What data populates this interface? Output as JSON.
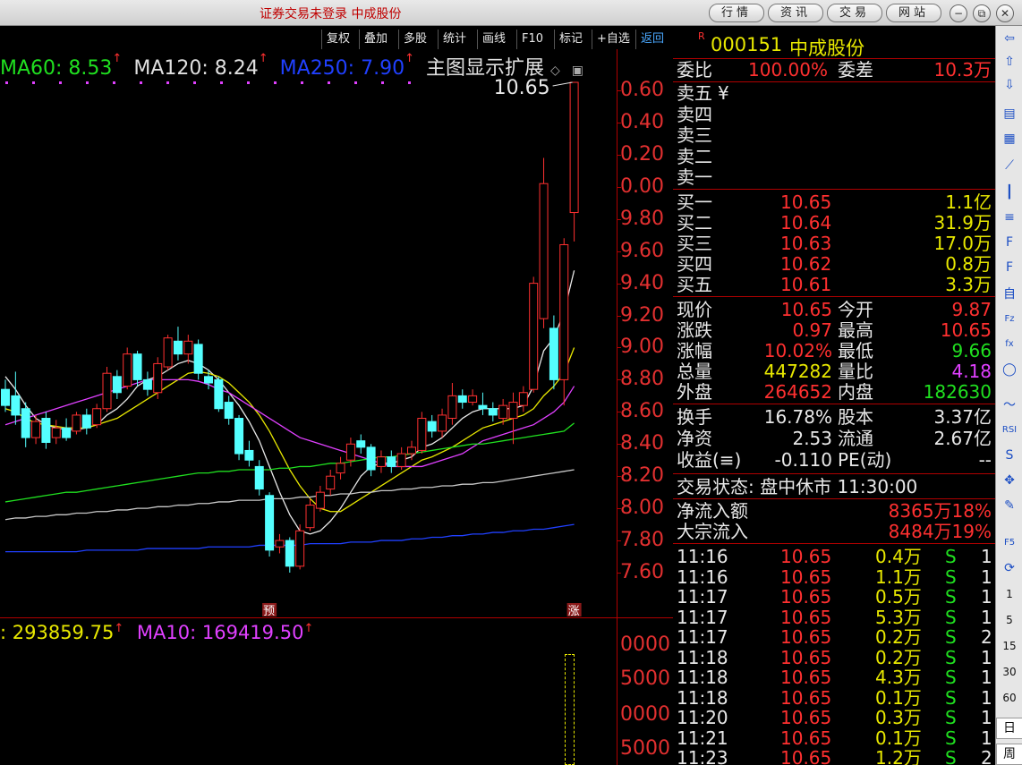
{
  "window": {
    "title": "证券交易未登录  中成股份",
    "top_buttons": [
      "行情",
      "资讯",
      "交易",
      "网站"
    ]
  },
  "toolbar": {
    "items": [
      "复权",
      "叠加",
      "多股",
      "统计",
      "画线",
      "F10",
      "标记",
      "+自选",
      "返回"
    ]
  },
  "ma_legend": {
    "ma60": "MA60: 8.53",
    "ma120": "MA120: 8.24",
    "ma250": "MA250: 7.90",
    "ext": "主图显示扩展",
    "colors": {
      "ma60": "#20e020",
      "ma120": "#e0e0e0",
      "ma250": "#2040ff",
      "ext": "#e0e0e0"
    }
  },
  "chart_data": {
    "type": "candlestick",
    "title": "",
    "ylim": [
      7.55,
      10.7
    ],
    "y_ticks": [
      "0.60",
      "0.40",
      "0.20",
      "0.00",
      "9.80",
      "9.60",
      "9.40",
      "9.20",
      "9.00",
      "8.80",
      "8.60",
      "8.40",
      "8.20",
      "8.00",
      "7.80",
      "7.60"
    ],
    "y_tick_values": [
      10.6,
      10.4,
      10.2,
      10.0,
      9.8,
      9.6,
      9.4,
      9.2,
      9.0,
      8.8,
      8.6,
      8.4,
      8.2,
      8.0,
      7.8,
      7.6
    ],
    "high_annotation": "10.65",
    "candles": [
      {
        "o": 8.74,
        "c": 8.64,
        "h": 8.8,
        "l": 8.6
      },
      {
        "o": 8.7,
        "c": 8.58,
        "h": 8.85,
        "l": 8.52
      },
      {
        "o": 8.62,
        "c": 8.44,
        "h": 8.66,
        "l": 8.38
      },
      {
        "o": 8.44,
        "c": 8.54,
        "h": 8.58,
        "l": 8.4
      },
      {
        "o": 8.56,
        "c": 8.41,
        "h": 8.6,
        "l": 8.37
      },
      {
        "o": 8.44,
        "c": 8.5,
        "h": 8.55,
        "l": 8.4
      },
      {
        "o": 8.5,
        "c": 8.44,
        "h": 8.56,
        "l": 8.42
      },
      {
        "o": 8.48,
        "c": 8.58,
        "h": 8.6,
        "l": 8.46
      },
      {
        "o": 8.58,
        "c": 8.5,
        "h": 8.62,
        "l": 8.46
      },
      {
        "o": 8.52,
        "c": 8.62,
        "h": 8.65,
        "l": 8.5
      },
      {
        "o": 8.62,
        "c": 8.84,
        "h": 8.88,
        "l": 8.6
      },
      {
        "o": 8.82,
        "c": 8.72,
        "h": 8.86,
        "l": 8.68
      },
      {
        "o": 8.76,
        "c": 8.96,
        "h": 9.0,
        "l": 8.74
      },
      {
        "o": 8.96,
        "c": 8.8,
        "h": 8.98,
        "l": 8.76
      },
      {
        "o": 8.8,
        "c": 8.74,
        "h": 8.85,
        "l": 8.7
      },
      {
        "o": 8.72,
        "c": 8.9,
        "h": 8.94,
        "l": 8.68
      },
      {
        "o": 8.88,
        "c": 9.06,
        "h": 9.08,
        "l": 8.86
      },
      {
        "o": 9.04,
        "c": 8.96,
        "h": 9.13,
        "l": 8.92
      },
      {
        "o": 8.96,
        "c": 9.04,
        "h": 9.08,
        "l": 8.9
      },
      {
        "o": 9.02,
        "c": 8.84,
        "h": 9.05,
        "l": 8.8
      },
      {
        "o": 8.82,
        "c": 8.78,
        "h": 8.86,
        "l": 8.74
      },
      {
        "o": 8.8,
        "c": 8.62,
        "h": 8.82,
        "l": 8.6
      },
      {
        "o": 8.66,
        "c": 8.56,
        "h": 8.7,
        "l": 8.52
      },
      {
        "o": 8.56,
        "c": 8.34,
        "h": 8.58,
        "l": 8.3
      },
      {
        "o": 8.36,
        "c": 8.3,
        "h": 8.42,
        "l": 8.26
      },
      {
        "o": 8.26,
        "c": 8.12,
        "h": 8.3,
        "l": 8.08
      },
      {
        "o": 8.08,
        "c": 7.74,
        "h": 8.1,
        "l": 7.7
      },
      {
        "o": 7.76,
        "c": 7.8,
        "h": 7.84,
        "l": 7.72
      },
      {
        "o": 7.8,
        "c": 7.64,
        "h": 7.82,
        "l": 7.6
      },
      {
        "o": 7.64,
        "c": 7.86,
        "h": 7.9,
        "l": 7.62
      },
      {
        "o": 7.88,
        "c": 8.02,
        "h": 8.06,
        "l": 7.86
      },
      {
        "o": 8.0,
        "c": 8.1,
        "h": 8.14,
        "l": 7.98
      },
      {
        "o": 8.12,
        "c": 8.2,
        "h": 8.24,
        "l": 8.08
      },
      {
        "o": 8.22,
        "c": 8.28,
        "h": 8.32,
        "l": 8.18
      },
      {
        "o": 8.3,
        "c": 8.4,
        "h": 8.44,
        "l": 8.26
      },
      {
        "o": 8.42,
        "c": 8.38,
        "h": 8.46,
        "l": 8.34
      },
      {
        "o": 8.38,
        "c": 8.24,
        "h": 8.4,
        "l": 8.2
      },
      {
        "o": 8.26,
        "c": 8.32,
        "h": 8.36,
        "l": 8.22
      },
      {
        "o": 8.32,
        "c": 8.26,
        "h": 8.36,
        "l": 8.22
      },
      {
        "o": 8.26,
        "c": 8.34,
        "h": 8.38,
        "l": 8.24
      },
      {
        "o": 8.34,
        "c": 8.38,
        "h": 8.42,
        "l": 8.3
      },
      {
        "o": 8.36,
        "c": 8.56,
        "h": 8.6,
        "l": 8.34
      },
      {
        "o": 8.54,
        "c": 8.48,
        "h": 8.58,
        "l": 8.44
      },
      {
        "o": 8.48,
        "c": 8.58,
        "h": 8.62,
        "l": 8.44
      },
      {
        "o": 8.56,
        "c": 8.7,
        "h": 8.78,
        "l": 8.52
      },
      {
        "o": 8.7,
        "c": 8.66,
        "h": 8.74,
        "l": 8.62
      },
      {
        "o": 8.66,
        "c": 8.7,
        "h": 8.74,
        "l": 8.64
      },
      {
        "o": 8.64,
        "c": 8.62,
        "h": 8.72,
        "l": 8.58
      },
      {
        "o": 8.62,
        "c": 8.58,
        "h": 8.66,
        "l": 8.54
      },
      {
        "o": 8.56,
        "c": 8.64,
        "h": 8.68,
        "l": 8.52
      },
      {
        "o": 8.56,
        "c": 8.66,
        "h": 8.72,
        "l": 8.4
      },
      {
        "o": 8.64,
        "c": 8.72,
        "h": 8.76,
        "l": 8.6
      },
      {
        "o": 8.74,
        "c": 9.4,
        "h": 9.44,
        "l": 8.72
      },
      {
        "o": 9.18,
        "c": 10.02,
        "h": 10.18,
        "l": 9.12
      },
      {
        "o": 9.12,
        "c": 8.8,
        "h": 9.2,
        "l": 8.74
      },
      {
        "o": 8.8,
        "c": 9.64,
        "h": 9.68,
        "l": 8.64
      },
      {
        "o": 9.84,
        "c": 10.65,
        "h": 10.65,
        "l": 9.66
      }
    ],
    "ma_lines": [
      {
        "color": "#e8e8e8",
        "values": [
          8.82,
          8.74,
          8.64,
          8.56,
          8.52,
          8.5,
          8.49,
          8.49,
          8.5,
          8.52,
          8.58,
          8.62,
          8.68,
          8.76,
          8.8,
          8.82,
          8.86,
          8.9,
          8.92,
          8.9,
          8.86,
          8.8,
          8.72,
          8.64,
          8.54,
          8.42,
          8.26,
          8.1,
          7.96,
          7.86,
          7.84,
          7.86,
          7.92,
          8.0,
          8.1,
          8.2,
          8.26,
          8.28,
          8.28,
          8.3,
          8.32,
          8.38,
          8.4,
          8.44,
          8.5,
          8.56,
          8.6,
          8.62,
          8.62,
          8.62,
          8.62,
          8.64,
          8.76,
          8.98,
          9.06,
          9.22,
          9.48
        ]
      },
      {
        "color": "#e8e800",
        "values": [
          8.62,
          8.6,
          8.56,
          8.53,
          8.52,
          8.51,
          8.5,
          8.5,
          8.5,
          8.52,
          8.54,
          8.56,
          8.6,
          8.64,
          8.68,
          8.72,
          8.76,
          8.8,
          8.84,
          8.85,
          8.84,
          8.82,
          8.78,
          8.72,
          8.66,
          8.58,
          8.48,
          8.36,
          8.24,
          8.14,
          8.06,
          8.0,
          7.98,
          7.98,
          8.02,
          8.06,
          8.1,
          8.14,
          8.18,
          8.22,
          8.26,
          8.3,
          8.32,
          8.35,
          8.38,
          8.42,
          8.46,
          8.5,
          8.52,
          8.54,
          8.56,
          8.58,
          8.62,
          8.7,
          8.76,
          8.84,
          9.0
        ]
      },
      {
        "color": "#e040ff",
        "values": [
          8.52,
          8.54,
          8.56,
          8.58,
          8.6,
          8.62,
          8.64,
          8.66,
          8.68,
          8.7,
          8.72,
          8.74,
          8.76,
          8.78,
          8.8,
          8.8,
          8.8,
          8.8,
          8.8,
          8.79,
          8.77,
          8.74,
          8.72,
          8.68,
          8.64,
          8.6,
          8.56,
          8.52,
          8.48,
          8.44,
          8.42,
          8.4,
          8.38,
          8.36,
          8.34,
          8.32,
          8.3,
          8.28,
          8.26,
          8.26,
          8.26,
          8.26,
          8.28,
          8.3,
          8.32,
          8.34,
          8.38,
          8.42,
          8.44,
          8.46,
          8.48,
          8.5,
          8.52,
          8.56,
          8.6,
          8.66,
          8.76
        ]
      },
      {
        "color": "#20e020",
        "values": [
          8.04,
          8.05,
          8.06,
          8.07,
          8.08,
          8.09,
          8.1,
          8.1,
          8.11,
          8.12,
          8.13,
          8.14,
          8.15,
          8.16,
          8.17,
          8.18,
          8.19,
          8.2,
          8.21,
          8.22,
          8.22,
          8.23,
          8.23,
          8.24,
          8.24,
          8.24,
          8.24,
          8.25,
          8.25,
          8.26,
          8.26,
          8.27,
          8.28,
          8.28,
          8.29,
          8.3,
          8.31,
          8.32,
          8.32,
          8.33,
          8.34,
          8.35,
          8.36,
          8.37,
          8.38,
          8.39,
          8.4,
          8.4,
          8.41,
          8.42,
          8.43,
          8.44,
          8.45,
          8.46,
          8.47,
          8.48,
          8.53
        ]
      },
      {
        "color": "#c8c8c8",
        "values": [
          7.93,
          7.94,
          7.94,
          7.95,
          7.95,
          7.96,
          7.96,
          7.97,
          7.97,
          7.98,
          7.98,
          7.99,
          7.99,
          8.0,
          8.0,
          8.01,
          8.01,
          8.02,
          8.02,
          8.03,
          8.03,
          8.04,
          8.04,
          8.05,
          8.05,
          8.05,
          8.06,
          8.06,
          8.06,
          8.07,
          8.07,
          8.08,
          8.08,
          8.09,
          8.09,
          8.1,
          8.1,
          8.11,
          8.11,
          8.12,
          8.12,
          8.13,
          8.13,
          8.14,
          8.14,
          8.15,
          8.15,
          8.16,
          8.16,
          8.17,
          8.18,
          8.19,
          8.2,
          8.21,
          8.22,
          8.23,
          8.24
        ]
      },
      {
        "color": "#2040ff",
        "values": [
          7.73,
          7.73,
          7.73,
          7.73,
          7.73,
          7.73,
          7.73,
          7.73,
          7.74,
          7.74,
          7.74,
          7.74,
          7.74,
          7.74,
          7.75,
          7.75,
          7.75,
          7.75,
          7.75,
          7.75,
          7.76,
          7.76,
          7.76,
          7.76,
          7.76,
          7.77,
          7.77,
          7.77,
          7.77,
          7.77,
          7.78,
          7.78,
          7.78,
          7.78,
          7.79,
          7.79,
          7.79,
          7.8,
          7.8,
          7.8,
          7.81,
          7.81,
          7.82,
          7.82,
          7.83,
          7.83,
          7.84,
          7.84,
          7.85,
          7.85,
          7.86,
          7.86,
          7.87,
          7.87,
          7.88,
          7.89,
          7.9
        ]
      }
    ],
    "markers": [
      {
        "label": "预",
        "candle": 26
      },
      {
        "label": "涨",
        "candle": 56
      }
    ]
  },
  "volume": {
    "legend_ma5": ": 293859.75",
    "legend_ma10": "MA10: 169419.50",
    "axis_ticks": [
      "0000",
      "5000",
      "0000",
      "5000"
    ]
  },
  "quote": {
    "code": "000151",
    "name": "中成股份",
    "r_mark": "R",
    "weibi_label": "委比",
    "weibi_value": "100.00%",
    "weicha_label": "委差",
    "weicha_value": "10.3万",
    "sell": [
      {
        "label": "卖五",
        "extra": "¥"
      },
      {
        "label": "卖四",
        "extra": ""
      },
      {
        "label": "卖三",
        "extra": ""
      },
      {
        "label": "卖二",
        "extra": ""
      },
      {
        "label": "卖一",
        "extra": ""
      }
    ],
    "buy": [
      {
        "label": "买一",
        "price": "10.65",
        "vol": "1.1亿"
      },
      {
        "label": "买二",
        "price": "10.64",
        "vol": "31.9万"
      },
      {
        "label": "买三",
        "price": "10.63",
        "vol": "17.0万"
      },
      {
        "label": "买四",
        "price": "10.62",
        "vol": "0.8万"
      },
      {
        "label": "买五",
        "price": "10.61",
        "vol": "3.3万"
      }
    ],
    "stats": [
      {
        "l1": "现价",
        "v1": "10.65",
        "c1": "red",
        "l2": "今开",
        "v2": "9.87",
        "c2": "red"
      },
      {
        "l1": "涨跌",
        "v1": "0.97",
        "c1": "red",
        "l2": "最高",
        "v2": "10.65",
        "c2": "red"
      },
      {
        "l1": "涨幅",
        "v1": "10.02%",
        "c1": "red",
        "l2": "最低",
        "v2": "9.66",
        "c2": "grn"
      },
      {
        "l1": "总量",
        "v1": "447282",
        "c1": "yel",
        "l2": "量比",
        "v2": "4.18",
        "c2": "mag"
      },
      {
        "l1": "外盘",
        "v1": "264652",
        "c1": "red",
        "l2": "内盘",
        "v2": "182630",
        "c2": "grn"
      },
      {
        "l1": "换手",
        "v1": "16.78%",
        "c1": "wht",
        "l2": "股本",
        "v2": "3.37亿",
        "c2": "wht"
      },
      {
        "l1": "净资",
        "v1": "2.53",
        "c1": "wht",
        "l2": "流通",
        "v2": "2.67亿",
        "c2": "wht"
      },
      {
        "l1": "收益(≡)",
        "v1": "-0.110",
        "c1": "wht",
        "l2": "PE(动)",
        "v2": "--",
        "c2": "wht"
      }
    ],
    "status": "交易状态: 盘中休市 11:30:00",
    "flow": [
      {
        "label": "净流入额",
        "value": "8365万18%"
      },
      {
        "label": "大宗流入",
        "value": "8484万19%"
      }
    ],
    "ticks": [
      {
        "t": "11:16",
        "p": "10.65",
        "v": "0.4万",
        "s": "S",
        "n": "1"
      },
      {
        "t": "11:16",
        "p": "10.65",
        "v": "1.1万",
        "s": "S",
        "n": "1"
      },
      {
        "t": "11:17",
        "p": "10.65",
        "v": "0.5万",
        "s": "S",
        "n": "1"
      },
      {
        "t": "11:17",
        "p": "10.65",
        "v": "5.3万",
        "s": "S",
        "n": "1"
      },
      {
        "t": "11:17",
        "p": "10.65",
        "v": "0.2万",
        "s": "S",
        "n": "2"
      },
      {
        "t": "11:18",
        "p": "10.65",
        "v": "0.2万",
        "s": "S",
        "n": "1"
      },
      {
        "t": "11:18",
        "p": "10.65",
        "v": "4.3万",
        "s": "S",
        "n": "1"
      },
      {
        "t": "11:18",
        "p": "10.65",
        "v": "0.1万",
        "s": "S",
        "n": "1"
      },
      {
        "t": "11:20",
        "p": "10.65",
        "v": "0.3万",
        "s": "S",
        "n": "1"
      },
      {
        "t": "11:21",
        "p": "10.65",
        "v": "0.1万",
        "s": "S",
        "n": "1"
      },
      {
        "t": "11:23",
        "p": "10.65",
        "v": "1.2万",
        "s": "S",
        "n": "2"
      }
    ]
  },
  "sidebar": {
    "icons": [
      "chevron-left-icon",
      "arrow-up-icon",
      "arrow-down-icon",
      "news-icon",
      "grid-icon",
      "line-chart-icon",
      "candlestick-icon",
      "list-icon",
      "f10-icon",
      "finance-icon",
      "self-icon",
      "fiz-icon",
      "formula-icon",
      "circle-icon",
      "wave-icon",
      "rsi-icon",
      "chart-s-icon",
      "move-icon",
      "pencil-icon",
      "f5-icon",
      "refresh-icon"
    ],
    "icon_glyphs": [
      "⇦",
      "⇧",
      "⇩",
      "▤",
      "▦",
      "⟋",
      "┃",
      "≡",
      "F",
      "F",
      "自",
      "Fz",
      "fx",
      "◯",
      "〜",
      "RSI",
      "S",
      "✥",
      "✎",
      "F5",
      "⟳"
    ],
    "periods": [
      "1",
      "5",
      "15",
      "30",
      "60",
      "日",
      "周"
    ]
  }
}
